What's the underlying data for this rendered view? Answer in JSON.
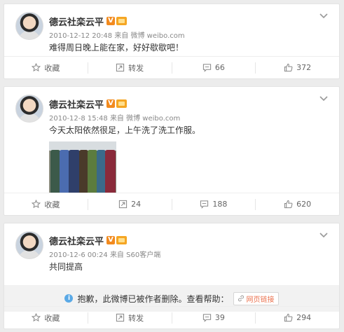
{
  "posts": [
    {
      "name": "德云社栾云平",
      "vbadge": "V",
      "time": "2010-12-12 20:48",
      "from_prefix": "来自",
      "source": "微博 weibo.com",
      "text": "难得周日晚上能在家，好好歇歇吧！",
      "actions": {
        "fav": "收藏",
        "repost": "转发",
        "comments": "66",
        "likes": "372"
      }
    },
    {
      "name": "德云社栾云平",
      "vbadge": "V",
      "time": "2010-12-8 15:48",
      "from_prefix": "来自",
      "source": "微博 weibo.com",
      "text": "今天太阳依然很足，上午洗了洗工作服。",
      "actions": {
        "fav": "收藏",
        "repost": "24",
        "comments": "188",
        "likes": "620"
      }
    },
    {
      "name": "德云社栾云平",
      "vbadge": "V",
      "time": "2010-12-6 00:24",
      "from_prefix": "来自",
      "source": "S60客户端",
      "text": "共同提高",
      "deleted_notice": "抱歉，此微博已被作者删除。查看帮助：",
      "help_link": "网页链接",
      "actions": {
        "fav": "收藏",
        "repost": "转发",
        "comments": "39",
        "likes": "294"
      }
    }
  ],
  "icons": {
    "more": "chevron-down-icon",
    "fav": "star-icon",
    "repost": "repost-icon",
    "comment": "comment-icon",
    "like": "thumbs-up-icon",
    "info": "info-icon",
    "link": "link-icon"
  },
  "colors": {
    "background": "#ececec",
    "accent": "#eb7350",
    "vbadge": "#f28a1e",
    "info": "#5aa9e6"
  }
}
